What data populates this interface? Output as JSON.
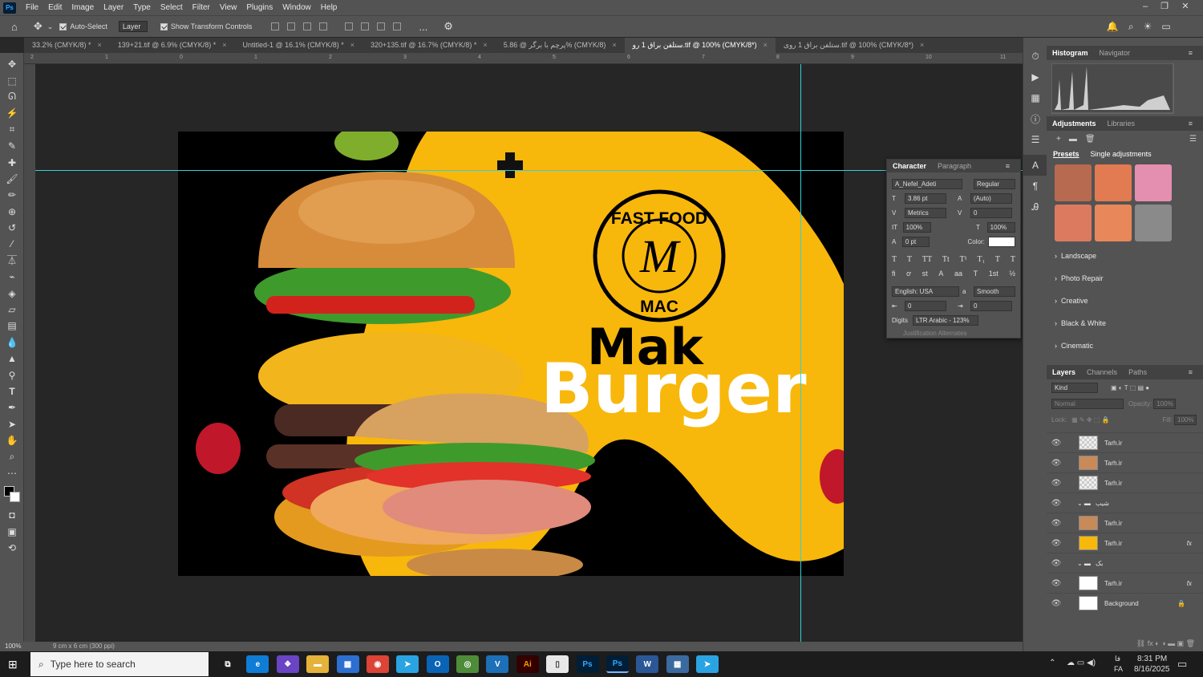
{
  "menu": [
    "File",
    "Edit",
    "Image",
    "Layer",
    "Type",
    "Select",
    "Filter",
    "View",
    "Plugins",
    "Window",
    "Help"
  ],
  "options": {
    "auto_select_label": "Auto-Select",
    "layer_dropdown": "Layer",
    "show_transform_label": "Show Transform Controls",
    "more_icon": "..."
  },
  "tabs": [
    {
      "label": "33.2% (CMYK/8) *"
    },
    {
      "label": "139+21.tif @ 6.9% (CMYK/8) *"
    },
    {
      "label": "Untitled-1 @ 16.1% (CMYK/8) *"
    },
    {
      "label": "320+135.tif @ 16.7% (CMYK/8) *"
    },
    {
      "label": "پرچم با برگر @ 5.86% (CMYK/8)"
    },
    {
      "label": "ستلفن براق 1 رو.tif @ 100% (CMYK/8*)",
      "active": true
    },
    {
      "label": "ستلفن براق 1 روی.tif @ 100% (CMYK/8*)"
    }
  ],
  "ruler_top": [
    "2",
    "1",
    "0",
    "1",
    "2",
    "3",
    "4",
    "5",
    "6",
    "7",
    "8",
    "9",
    "10",
    "11"
  ],
  "artwork": {
    "logo_top": "FAST FOOD",
    "logo_monogram": "M",
    "logo_bottom": "MAC",
    "headline_1": "Mak",
    "headline_2": "Burger",
    "colors": {
      "yellow": "#f8b70b",
      "black": "#000000",
      "white": "#ffffff"
    }
  },
  "status": {
    "zoom": "100%",
    "doc_size": "9 cm x 6 cm (300 ppi)"
  },
  "histogram_panel": {
    "tabs": [
      "Histogram",
      "Navigator"
    ]
  },
  "adjustments_panel": {
    "tabs": [
      "Adjustments",
      "Libraries"
    ],
    "subtabs": [
      "Presets",
      "Single adjustments"
    ],
    "groups": [
      "Landscape",
      "Photo Repair",
      "Creative",
      "Black & White",
      "Cinematic"
    ]
  },
  "character_panel": {
    "tabs": [
      "Character",
      "Paragraph"
    ],
    "font_family": "A_Nefel_Adeti",
    "font_style": "Regular",
    "font_size": "3.86 pt",
    "leading": "(Auto)",
    "kerning": "Metrics",
    "tracking": "0",
    "vscale": "100%",
    "hscale": "100%",
    "baseline": "0 pt",
    "color_label": "Color:",
    "language": "English: USA",
    "antialias": "Smooth",
    "indent_left": "0",
    "indent_right": "0",
    "digits_label": "Digits",
    "digits_value": "LTR Arabic - 123%",
    "justification": "Justification Alternates"
  },
  "layers_panel": {
    "tabs": [
      "Layers",
      "Channels",
      "Paths"
    ],
    "kind": "Kind",
    "blend": "Normal",
    "opacity_label": "Opacity:",
    "opacity": "100%",
    "lock_label": "Lock:",
    "fill_label": "Fill:",
    "fill": "100%",
    "layers": [
      {
        "name": "Tarh.ir",
        "type": "checker"
      },
      {
        "name": "Tarh.ir",
        "type": "photo"
      },
      {
        "name": "Tarh.ir",
        "type": "checker"
      },
      {
        "name": "شیب",
        "type": "group"
      },
      {
        "name": "Tarh.ir",
        "type": "photo"
      },
      {
        "name": "Tarh.ir",
        "type": "yellow",
        "fx": true
      },
      {
        "name": "بک",
        "type": "group"
      },
      {
        "name": "Tarh.ir",
        "type": "white",
        "fx": true
      },
      {
        "name": "Background",
        "type": "white",
        "locked": true
      }
    ]
  },
  "taskbar": {
    "search_placeholder": "Type here to search",
    "time": "8:31 PM",
    "date": "8/16/2025",
    "lang": "FA",
    "ime": "ﻓﺎ"
  }
}
